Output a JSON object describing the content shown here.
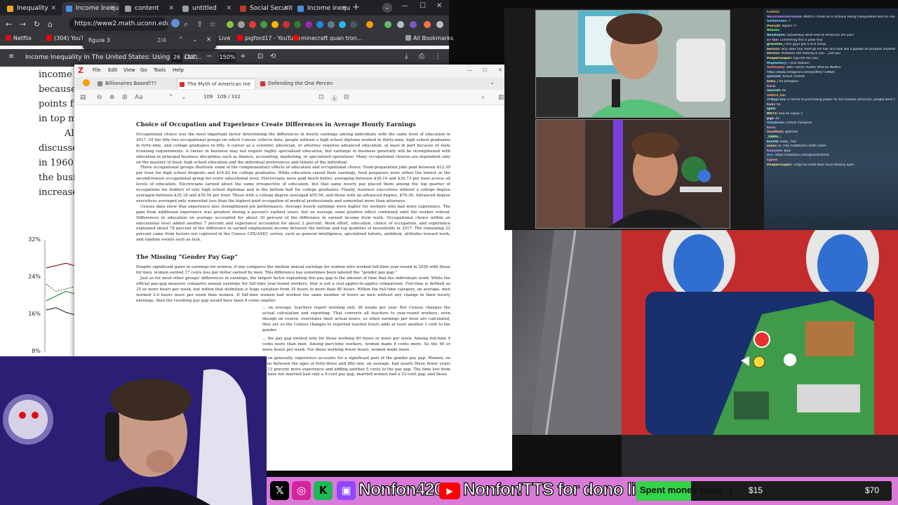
{
  "browser": {
    "tabs": [
      {
        "label": "Inequality",
        "color": "#f5a623"
      },
      {
        "label": "Income Inequ",
        "color": "#4a90e2"
      },
      {
        "label": "content",
        "color": "#9aa0a6"
      },
      {
        "label": "untitled",
        "color": "#9aa0a6"
      },
      {
        "label": "Social Securit",
        "color": "#c0392b"
      },
      {
        "label": "Income inequ",
        "color": "#4a90e2"
      }
    ],
    "url": "https://www2.math.uconn.edu/~bri...",
    "find": {
      "query": "figure 3",
      "count": "2/4"
    },
    "bookmarks": [
      "Netflix",
      "(304) YouTube",
      "Live",
      "pigford17 - YouTube",
      "minecraft quan tron...",
      "All Bookmarks"
    ],
    "pdf": {
      "title": "Income Inequality In The United States: Using Tax Dat...",
      "page": "26",
      "pages": "/ 121",
      "zoom": "150%"
    }
  },
  "background_pdf_text": [
    "income sh",
    "because t",
    "points fro",
    "in top ma",
    "Al",
    "discussed",
    "in 1960 a",
    "the busin",
    "increase in"
  ],
  "chart": {
    "ticks": [
      "32%",
      "24%",
      "16%",
      "8%"
    ]
  },
  "chart_data": {
    "type": "line",
    "title": "",
    "xlabel": "",
    "ylabel": "",
    "ylim": [
      8,
      32
    ],
    "y_ticks": [
      "32%",
      "24%",
      "16%",
      "8%"
    ],
    "series": [
      {
        "values": [
          26,
          26.5,
          27,
          26.5
        ]
      },
      {
        "values": [
          22.5,
          21,
          21.5,
          22
        ]
      },
      {
        "values": [
          19,
          20,
          21,
          20.5
        ]
      },
      {
        "values": [
          17,
          17.5,
          16.5,
          16
        ]
      }
    ]
  },
  "reader": {
    "menu": [
      "File",
      "Edit",
      "View",
      "Go",
      "Tools",
      "Help"
    ],
    "tabs": [
      "Billionaires Based???",
      "The Myth of American Ine",
      "Defending the One Percen"
    ],
    "page": "109",
    "page_info": "109 / 332",
    "heading1": "Choice of Occupation and Experience Create Differences in Average Hourly Earnings",
    "p1": "Occupational choice was the most important factor determining the differences in hourly earnings among individuals with the same level of education in 2017. Of the fifty-two occupational groups on which Census collects data, people without a high school diploma worked in thirty-nine, high school graduates in forty-nine, and college graduates in fifty. A career as a scientist, physician, or attorney requires advanced education, at least in part because of state licensing requirements. A career in business may not require highly specialized education, but earnings in business generally will be strengthened with education in principal business disciplines such as finance, accounting, marketing, or specialized operations. Many occupational choices are dependent only on the mastery of basic high school education and the individual preferences and talents of the individual.",
    "p2": "Three occupational groups illustrate some of the complementary effects of education and occupational choice. Food-preparation jobs paid between $12.39 per hour for high school dropouts and $16.82 for college graduates. While education raised their earnings, food preparers were either the lowest or the second-lowest occupational group for every educational level. Electricians were paid much better, averaging between $30.10 and $30.73 per hour across all levels of education. Electricians earned about the same irrespective of education, but that same hourly pay placed them among the top quarter of occupations for holders of only high school diplomas and in the bottom half for college graduates. Finally, business executives without a college degree averaged between $35.18 and $39.56 per hour. Those with a college degree averaged $55.56, and those with an advanced degree, $78.36. Advanced degree executives averaged only somewhat less than the highest-paid occupation of medical professionals and somewhat more than attorneys.",
    "p3": "Census data show that experience also strengthened job performance. Average hourly earnings were higher for workers who had more experience. The gain from additional experience was greatest during a person's earliest years, but on average some positive effect continued until the worker retired. Differences in education on average accounted for about 30 percent of the difference in earned income from work. Occupational choice within an educational level added another 7 percent and experience accounted for about 2 percent. Work effort, education, choice of occupation, and experience explained about 78 percent of the difference in earned employment income between the bottom and top quintiles of households in 2017. The remaining 22 percent came from factors not captured in the Census CPS/ASEC survey, such as general intelligence, specialized talents, ambition, attitudes toward work, and random events such as luck.",
    "heading2": "The Missing “Gender Pay Gap”",
    "p4": "Despite significant gains in earnings for women, if one compares the median annual earnings for women who worked full-time year-round in 2020 with those for men, women earned 17 cents less per dollar earned by men. This difference has sometimes been labeled the “gender pay gap.”",
    "p5": "Just as for most other groups' differences in earnings, the largest factor explaining this pay gap is the amount of time that the individuals work. While the official pay-gap measure compares annual earnings for full-time year-round workers, that is not a real apples-to-apples comparison. Full-time is defined as 35 or more hours per week, but within that definition is huge variation from 35 hours to more than 80 hours. Within the full-time category, on average, men worked 2.0 hours more per week than women. If full-time women had worked the same number of hours as men without any change in their hourly earnings, then the resulting pay gap would have been 4 cents smaller.",
    "p6": "... on average, teachers report working only 38 weeks per year. But Census changes the actual calculation and reporting. That converts all teachers to year-round workers, even though on course, overstates their actual hours, so when earnings per hour are calculated, they are so the Census changes to reported teacher hours adds at least another 1 cent to the gender",
    "p7": "... the pay gap existed only for those working 40 hours or more per week. Among full-time 4 cents more than men. Among part-time workers, women made 6 cents more. So the 40 or more hours per week. For those working fewer hours, women made more.",
    "p8": "... on generally, experience accounts for a significant part of the gender pay gap. Women, on even between the ages of forty-three and fifty-one, on average, had nearly three fewer years of 13 percent more experience and adding another 5 cents to the pay gap. The time lost from ... have not married had only a 9-cent pay gap, married women had a 22-cent gap, and those"
  },
  "chat": [
    {
      "user": "Comlio:",
      "text": "",
      "color": "#ffb347"
    },
    {
      "user": "VeryVioletVernanda:",
      "text": "Mattrix I think he is actively being manipulated and his valid feelings are being preyed on",
      "color": "#c39bff"
    },
    {
      "user": "hellofocker:",
      "text": "-I",
      "color": "#8fd3ff"
    },
    {
      "user": "PeacyD:",
      "text": "Vapers !!!",
      "color": "#ffd86b"
    },
    {
      "user": "Nebula:",
      "text": "",
      "color": "#7fff7f"
    },
    {
      "user": "NeoDamin:",
      "text": "oooooOkay what kind of American are you?",
      "color": "#9fe0ff"
    },
    {
      "user": "o7-ibe:",
      "text": "Crimmmng this is peak tiny",
      "color": "#ff9de0"
    },
    {
      "user": "granates_:",
      "text": "this guys got a nice setup",
      "color": "#b0ffb0"
    },
    {
      "user": "bernini:",
      "text": "why does tiny need go his hair and look like a goober on purpose anytime he does a public appearance or speaks to someone big",
      "color": "#ffd0a0"
    },
    {
      "user": "bernini:",
      "text": "thekbark hes looking at you ...just you",
      "color": "#ffd0a0"
    },
    {
      "user": "Poopercooper:",
      "text": "mg into my soul",
      "color": "#ffe680"
    },
    {
      "user": "Maplestory:",
      "text": "i love tealium",
      "color": "#80e0ff"
    },
    {
      "user": "fluffdaddy:",
      "text": "BRO THESE PEDRO PASCAL MEMES",
      "color": "#ff8080"
    },
    {
      "user": "",
      "text": "https://www.instagram.com/p/DMXJ7TSMBX/",
      "color": "#6fa8ff"
    },
    {
      "user": "sprbadt:",
      "text": "Actual context",
      "color": "#c0c0ff"
    },
    {
      "user": "babu_:",
      "text": "ho omegalul",
      "color": "#ffcc99"
    },
    {
      "user": "Kara:",
      "text": "",
      "color": "#ff99cc"
    },
    {
      "user": "noscott:",
      "text": "he",
      "color": "#99ffcc"
    },
    {
      "user": "anthro_tid:",
      "text": "",
      "color": "#ffaa66"
    },
    {
      "user": "TFRapTvrs:",
      "text": "in terms of purchasing power for the median american, people were richer in the decades after ww2",
      "color": "#b3d9ff"
    },
    {
      "user": "Kuki:",
      "text": "he",
      "color": "#ffb3b3"
    },
    {
      "user": "sprit:",
      "text": "",
      "color": "#ccffcc"
    },
    {
      "user": "MVTT:",
      "text": "And he vapes !!",
      "color": "#ffff99"
    },
    {
      "user": "pipi:",
      "text": "he",
      "color": "#ffccff"
    },
    {
      "user": "OnlyBrian:",
      "text": "critical misspeak",
      "color": "#99ccff"
    },
    {
      "user": "Kara:",
      "text": "",
      "color": "#ff99cc"
    },
    {
      "user": "UwuMum:",
      "text": "@bernel",
      "color": "#ffc299"
    },
    {
      "user": "_KANG_:",
      "text": "",
      "color": "#c2ff99"
    },
    {
      "user": "Ezorth:",
      "text": "kubo_ YOU",
      "color": "#99fff0"
    },
    {
      "user": "ossar:",
      "text": "IS THIS YEKINDAR FROM FURIA",
      "color": "#ffd699"
    },
    {
      "user": "Kanyone:",
      "text": "blue",
      "color": "#d699ff"
    },
    {
      "user": "Bot:",
      "text": "https://substack.com/@carlbistrent",
      "color": "#6fa8ff"
    },
    {
      "user": "typed:",
      "text": "",
      "color": "#ff9999"
    },
    {
      "user": "Poopercooper:",
      "text": "+htgl he kinda does have dreamy eyes",
      "color": "#ffe680"
    }
  ],
  "bar": {
    "handle_left": "Nonfon420",
    "handle_right": "Nonfon",
    "tts": "!TTS for dono link",
    "goal_label": "Spent money today :(",
    "goal_current": "$15",
    "goal_target": "$70",
    "goal_progress": 0.214
  }
}
